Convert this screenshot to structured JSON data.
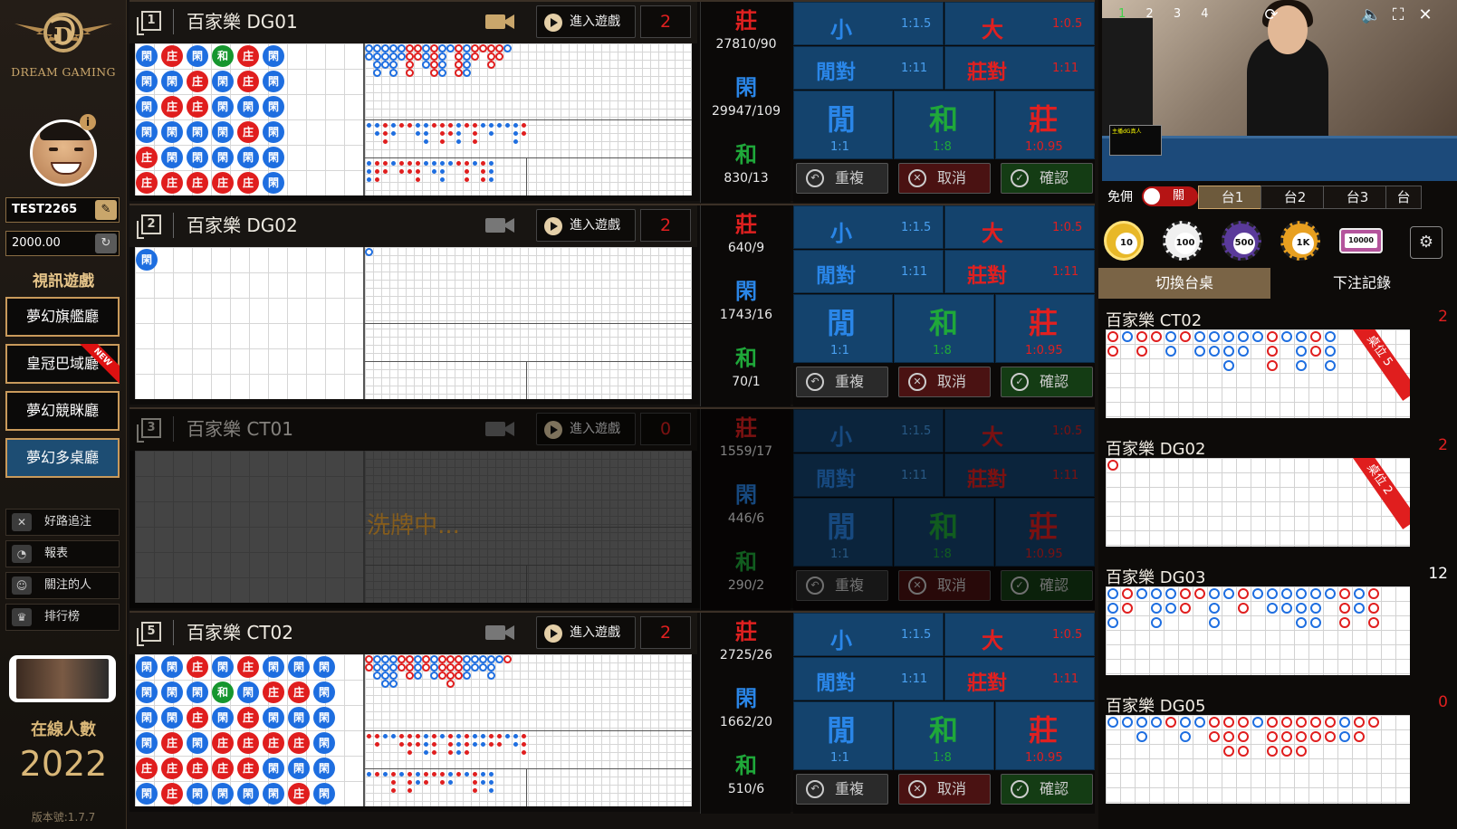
{
  "sidebar": {
    "logo_text": "DREAM GAMING",
    "username": "TEST2265",
    "balance": "2000.00",
    "section_title": "視訊遊戲",
    "halls": [
      {
        "label": "夢幻旗艦廳",
        "active": false,
        "new": false
      },
      {
        "label": "皇冠巴域廳",
        "active": false,
        "new": true
      },
      {
        "label": "夢幻競眯廳",
        "active": false,
        "new": false
      },
      {
        "label": "夢幻多桌廳",
        "active": true,
        "new": false
      }
    ],
    "new_badge": "NEW",
    "menu": [
      {
        "label": "好路追注",
        "icon": "close-box-icon"
      },
      {
        "label": "報表",
        "icon": "pie-chart-icon"
      },
      {
        "label": "關注的人",
        "icon": "user-icon"
      },
      {
        "label": "排行榜",
        "icon": "trophy-icon"
      }
    ],
    "online_label": "在線人數",
    "online_count": "2022",
    "version": "版本號:1.7.7"
  },
  "tables": [
    {
      "index": "1",
      "name": "百家樂 DG01",
      "enter_label": "進入遊戲",
      "count": "2",
      "camera_active": true,
      "shuffling": false,
      "dimmed": false,
      "stats": {
        "banker_label": "莊",
        "banker": "27810/90",
        "player_label": "閑",
        "player": "29947/109",
        "tie_label": "和",
        "tie": "830/13"
      },
      "bead_road": [
        [
          "P",
          "P",
          "P",
          "P",
          "B",
          "B"
        ],
        [
          "B",
          "P",
          "B",
          "P",
          "P",
          "B"
        ],
        [
          "P",
          "B",
          "B",
          "P",
          "P",
          "B"
        ],
        [
          "T",
          "P",
          "P",
          "P",
          "P",
          "B"
        ],
        [
          "B",
          "B",
          "P",
          "B",
          "P",
          "B"
        ],
        [
          "P",
          "P",
          "P",
          "P",
          "P",
          "P"
        ]
      ],
      "bead_text": {
        "P": "閑",
        "B": "庄",
        "T": "和"
      }
    },
    {
      "index": "2",
      "name": "百家樂 DG02",
      "enter_label": "進入遊戲",
      "count": "2",
      "camera_active": false,
      "shuffling": false,
      "dimmed": false,
      "stats": {
        "banker_label": "莊",
        "banker": "640/9",
        "player_label": "閑",
        "player": "1743/16",
        "tie_label": "和",
        "tie": "70/1"
      },
      "bead_road": [
        [
          "P"
        ]
      ],
      "bead_text": {
        "P": "閑",
        "B": "庄",
        "T": "和"
      }
    },
    {
      "index": "3",
      "name": "百家樂 CT01",
      "enter_label": "進入遊戲",
      "count": "0",
      "camera_active": false,
      "shuffling": true,
      "dimmed": true,
      "shuffle_text": "洗牌中...",
      "stats": {
        "banker_label": "莊",
        "banker": "1559/17",
        "player_label": "閑",
        "player": "446/6",
        "tie_label": "和",
        "tie": "290/2"
      },
      "bead_road": [],
      "bead_text": {
        "P": "閑",
        "B": "庄",
        "T": "和"
      }
    },
    {
      "index": "5",
      "name": "百家樂 CT02",
      "enter_label": "進入遊戲",
      "count": "2",
      "camera_active": false,
      "shuffling": false,
      "dimmed": false,
      "stats": {
        "banker_label": "莊",
        "banker": "2725/26",
        "player_label": "閑",
        "player": "1662/20",
        "tie_label": "和",
        "tie": "510/6"
      },
      "bead_road": [
        [
          "P",
          "P",
          "P",
          "P",
          "B",
          "P"
        ],
        [
          "P",
          "P",
          "P",
          "B",
          "B",
          "B"
        ],
        [
          "B",
          "P",
          "B",
          "P",
          "B",
          "P"
        ],
        [
          "P",
          "T",
          "P",
          "B",
          "B",
          "P"
        ],
        [
          "B",
          "P",
          "B",
          "B",
          "B",
          "P"
        ],
        [
          "P",
          "B",
          "P",
          "B",
          "P",
          "P"
        ],
        [
          "P",
          "B",
          "P",
          "B",
          "P",
          "B"
        ],
        [
          "P",
          "P",
          "P",
          "P",
          "P",
          "P"
        ]
      ],
      "bead_text": {
        "P": "閑",
        "B": "庄",
        "T": "和"
      }
    }
  ],
  "bet": {
    "small": "小",
    "small_odds": "1:1.5",
    "big": "大",
    "big_odds": "1:0.5",
    "player_pair": "閒對",
    "player_pair_odds": "1:11",
    "banker_pair": "莊對",
    "banker_pair_odds": "1:11",
    "player": "閒",
    "player_odds": "1:1",
    "tie": "和",
    "tie_odds": "1:8",
    "banker": "莊",
    "banker_odds": "1:0.95",
    "repeat": "重複",
    "cancel": "取消",
    "confirm": "確認"
  },
  "right": {
    "video_tabs": [
      "1",
      "2",
      "3",
      "4"
    ],
    "video_overlay": "主播dG真人",
    "free_label": "免佣",
    "toggle_label": "關",
    "table_tabs": [
      {
        "label": "台1",
        "active": true
      },
      {
        "label": "台2",
        "active": false
      },
      {
        "label": "台3",
        "active": false
      },
      {
        "label": "台",
        "active": false
      }
    ],
    "chips": [
      {
        "label": "10",
        "color": "#e8b828"
      },
      {
        "label": "100",
        "color": "#f0f0f0"
      },
      {
        "label": "500",
        "color": "#5a3a9a"
      },
      {
        "label": "1K",
        "color": "#e8a020"
      },
      {
        "label": "10000",
        "color": "#b4549c"
      }
    ],
    "switch_tab": "切換台桌",
    "history_tab": "下注記錄",
    "cards": [
      {
        "title": "百家樂 CT02",
        "count": "2",
        "count_color": "#e02020",
        "seat": "桌位 5"
      },
      {
        "title": "百家樂 DG02",
        "count": "2",
        "count_color": "#e02020",
        "seat": "桌位 2"
      },
      {
        "title": "百家樂 DG03",
        "count": "12",
        "count_color": "#ffffff",
        "seat": ""
      },
      {
        "title": "百家樂 DG05",
        "count": "0",
        "count_color": "#e02020",
        "seat": ""
      }
    ]
  },
  "colors": {
    "banker": "#e02020",
    "player": "#2a86e8",
    "tie": "#1fa83a",
    "gold": "#c9a66b",
    "bet_bg": "#14436d"
  }
}
